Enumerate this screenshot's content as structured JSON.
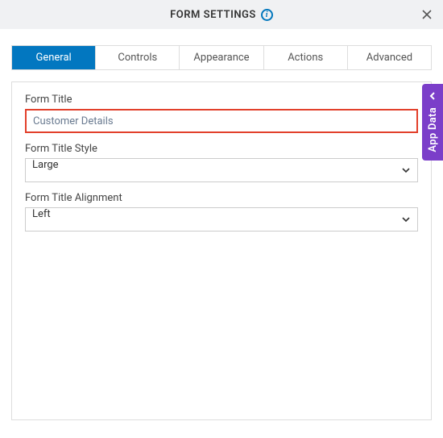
{
  "header": {
    "title": "FORM SETTINGS"
  },
  "tabs": [
    {
      "label": "General"
    },
    {
      "label": "Controls"
    },
    {
      "label": "Appearance"
    },
    {
      "label": "Actions"
    },
    {
      "label": "Advanced"
    }
  ],
  "fields": {
    "form_title": {
      "label": "Form Title",
      "value": "Customer Details"
    },
    "form_title_style": {
      "label": "Form Title Style",
      "value": "Large"
    },
    "form_title_alignment": {
      "label": "Form Title Alignment",
      "value": "Left"
    }
  },
  "side": {
    "label": "App Data"
  }
}
